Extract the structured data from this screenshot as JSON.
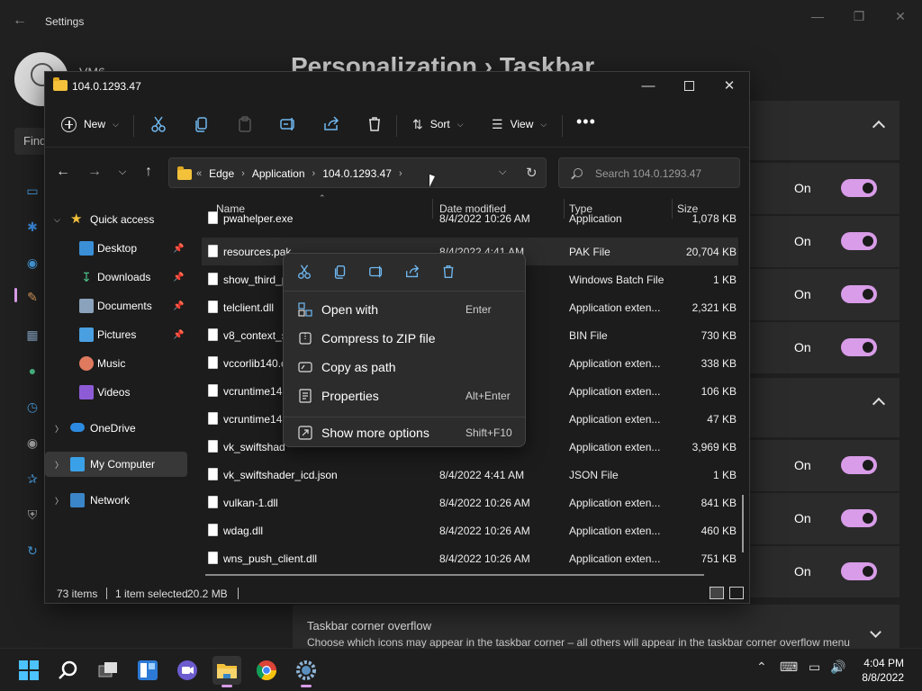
{
  "settings": {
    "title": "Settings",
    "user_name": "VM6",
    "search_partial": "Find",
    "breadcrumb": "Personalization  ›  Taskbar",
    "toggles": [
      {
        "label": "On"
      },
      {
        "label": "On"
      },
      {
        "label": "On"
      },
      {
        "label": "On"
      },
      {
        "label": "On"
      },
      {
        "label": "On"
      },
      {
        "label": "On"
      }
    ],
    "overflow": {
      "title": "Taskbar corner overflow",
      "description": "Choose which icons may appear in the taskbar corner – all others will appear in the taskbar corner overflow menu"
    },
    "accent_color": "#d89ce8"
  },
  "explorer": {
    "title": "104.0.1293.47",
    "toolbar": {
      "new_label": "New",
      "sort_label": "Sort",
      "view_label": "View",
      "more_label": "•••"
    },
    "address": {
      "overflow": "«",
      "crumbs": [
        "Edge",
        "Application",
        "104.0.1293.47"
      ]
    },
    "search": {
      "placeholder": "Search 104.0.1293.47"
    },
    "nav": {
      "quick_access": "Quick access",
      "desktop": "Desktop",
      "downloads": "Downloads",
      "documents": "Documents",
      "pictures": "Pictures",
      "music": "Music",
      "videos": "Videos",
      "onedrive": "OneDrive",
      "my_computer": "My Computer",
      "network": "Network"
    },
    "columns": {
      "name": "Name",
      "date": "Date modified",
      "type": "Type",
      "size": "Size"
    },
    "files": [
      {
        "name": "pwahelper.exe",
        "date": "8/4/2022 10:26 AM",
        "type": "Application",
        "size": "1,078 KB"
      },
      {
        "name": "resources.pak",
        "date": "8/4/2022 4:41 AM",
        "type": "PAK File",
        "size": "20,704 KB"
      },
      {
        "name": "show_third_p",
        "date": "",
        "type": "Windows Batch File",
        "size": "1 KB"
      },
      {
        "name": "telclient.dll",
        "date": "",
        "type": "Application exten...",
        "size": "2,321 KB"
      },
      {
        "name": "v8_context_s",
        "date": "",
        "type": "BIN File",
        "size": "730 KB"
      },
      {
        "name": "vccorlib140.c",
        "date": "",
        "type": "Application exten...",
        "size": "338 KB"
      },
      {
        "name": "vcruntime14",
        "date": "",
        "type": "Application exten...",
        "size": "106 KB"
      },
      {
        "name": "vcruntime14",
        "date": "",
        "type": "Application exten...",
        "size": "47 KB"
      },
      {
        "name": "vk_swiftshad",
        "date": "",
        "type": "Application exten...",
        "size": "3,969 KB"
      },
      {
        "name": "vk_swiftshader_icd.json",
        "date": "8/4/2022 4:41 AM",
        "type": "JSON File",
        "size": "1 KB"
      },
      {
        "name": "vulkan-1.dll",
        "date": "8/4/2022 10:26 AM",
        "type": "Application exten...",
        "size": "841 KB"
      },
      {
        "name": "wdag.dll",
        "date": "8/4/2022 10:26 AM",
        "type": "Application exten...",
        "size": "460 KB"
      },
      {
        "name": "wns_push_client.dll",
        "date": "8/4/2022 10:26 AM",
        "type": "Application exten...",
        "size": "751 KB"
      }
    ],
    "status": {
      "count": "73 items",
      "selected": "1 item selected",
      "size": "20.2 MB"
    },
    "context_menu": {
      "items": [
        {
          "label": "Open with",
          "shortcut": "Enter"
        },
        {
          "label": "Compress to ZIP file",
          "shortcut": ""
        },
        {
          "label": "Copy as path",
          "shortcut": ""
        },
        {
          "label": "Properties",
          "shortcut": "Alt+Enter"
        },
        {
          "label": "Show more options",
          "shortcut": "Shift+F10"
        }
      ]
    }
  },
  "taskbar": {
    "time": "4:04 PM",
    "date": "8/8/2022"
  }
}
